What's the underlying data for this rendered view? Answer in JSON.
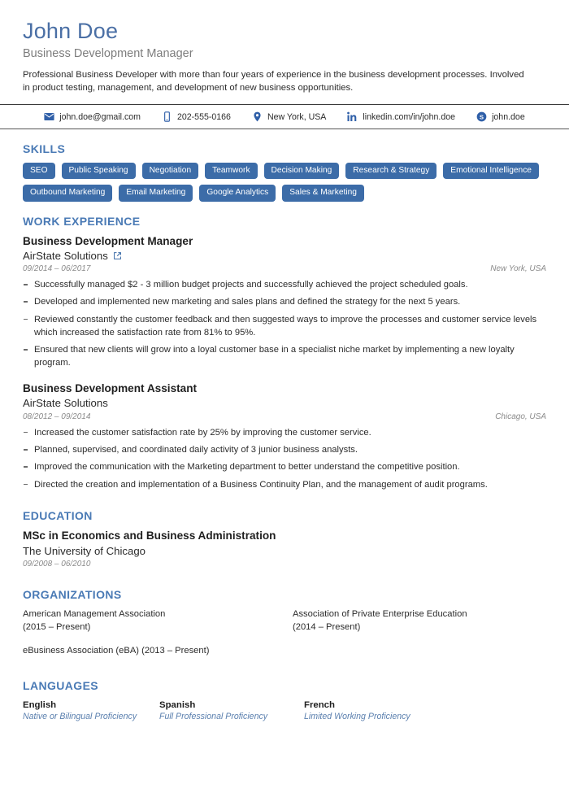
{
  "header": {
    "name": "John Doe",
    "job_title": "Business Development Manager",
    "summary": "Professional Business Developer with more than four years of experience in the business development processes. Involved in product testing, management, and development of new business opportunities."
  },
  "contact": [
    {
      "icon": "email-icon",
      "value": "john.doe@gmail.com"
    },
    {
      "icon": "phone-icon",
      "value": "202-555-0166"
    },
    {
      "icon": "location-pin-icon",
      "value": "New York, USA"
    },
    {
      "icon": "linkedin-icon",
      "value": "linkedin.com/in/john.doe"
    },
    {
      "icon": "skype-icon",
      "value": "john.doe"
    }
  ],
  "skills": {
    "title": "SKILLS",
    "items": [
      "SEO",
      "Public Speaking",
      "Negotiation",
      "Teamwork",
      "Decision Making",
      "Research & Strategy",
      "Emotional Intelligence",
      "Outbound Marketing",
      "Email Marketing",
      "Google Analytics",
      "Sales & Marketing"
    ]
  },
  "work_experience": {
    "title": "WORK EXPERIENCE",
    "jobs": [
      {
        "role": "Business Development Manager",
        "company": "AirState Solutions",
        "has_link": true,
        "link_icon": "external-link-icon",
        "dates": "09/2014 – 06/2017",
        "location": "New York, USA",
        "bullets": [
          "Successfully managed $2 - 3 million budget projects and successfully achieved the project scheduled goals.",
          "Developed and implemented new marketing and sales plans and defined the strategy for the next 5 years.",
          "Reviewed constantly the customer feedback and then suggested ways to improve the processes and customer service levels which increased the satisfaction rate from 81% to 95%.",
          "Ensured that new clients will grow into a loyal customer base in a specialist niche market by implementing a new loyalty program."
        ]
      },
      {
        "role": "Business Development Assistant",
        "company": "AirState Solutions",
        "has_link": false,
        "link_icon": "",
        "dates": "08/2012 – 09/2014",
        "location": "Chicago, USA",
        "bullets": [
          "Increased the customer satisfaction rate by 25% by improving the customer service.",
          "Planned, supervised, and coordinated daily activity of 3 junior business analysts.",
          "Improved the communication with the Marketing department to better understand the competitive position.",
          "Directed the creation and implementation of a Business Continuity Plan, and the management of audit programs."
        ]
      }
    ]
  },
  "education": {
    "title": "EDUCATION",
    "entries": [
      {
        "degree": "MSc in Economics and Business Administration",
        "school": "The University of Chicago",
        "dates": "09/2008 – 06/2010"
      }
    ]
  },
  "organizations": {
    "title": "ORGANIZATIONS",
    "items": [
      {
        "name": "American Management Association",
        "years": "(2015 – Present)"
      },
      {
        "name": "Association of Private Enterprise Education",
        "years": "(2014 – Present)"
      },
      {
        "name": "eBusiness Association (eBA) (2013 – Present)",
        "years": ""
      }
    ]
  },
  "languages": {
    "title": "LANGUAGES",
    "items": [
      {
        "name": "English",
        "level": "Native or Bilingual Proficiency"
      },
      {
        "name": "Spanish",
        "level": "Full Professional Proficiency"
      },
      {
        "name": "French",
        "level": "Limited Working Proficiency"
      }
    ]
  },
  "colors": {
    "name_blue": "#4a6fa5",
    "section_heading_blue": "#4a7ab5",
    "pill_blue": "#3c6ca8",
    "icon_blue": "#2f5fa8",
    "muted_gray": "#8a8a8a",
    "lang_level_blue": "#5a7fae"
  }
}
